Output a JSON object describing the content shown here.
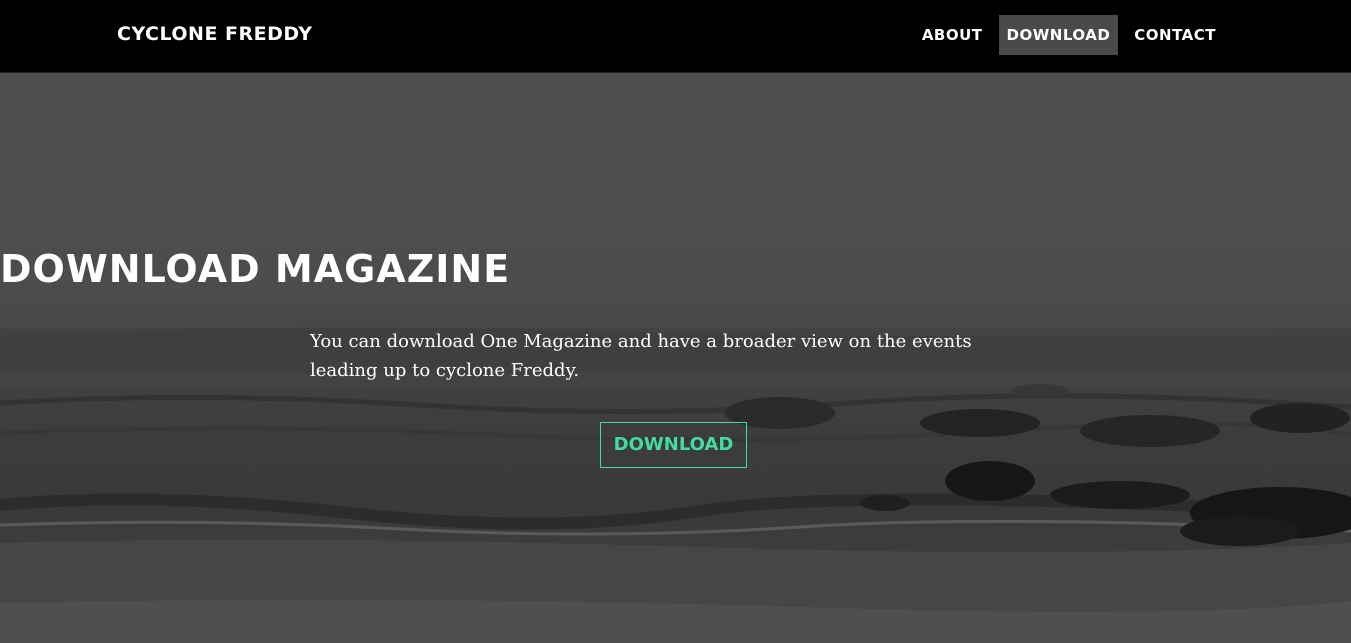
{
  "navbar": {
    "brand": "CYCLONE FREDDY",
    "links": [
      {
        "label": "ABOUT"
      },
      {
        "label": "DOWNLOAD"
      },
      {
        "label": "CONTACT"
      }
    ],
    "active": "DOWNLOAD"
  },
  "hero": {
    "title": "DOWNLOAD MAGAZINE",
    "description": "You can download One Magazine and have a broader view on the events leading up to cyclone Freddy.",
    "button_label": "DOWNLOAD"
  },
  "colors": {
    "accent": "#42dca3",
    "navbar_bg": "#000000",
    "active_nav_bg": "#4a4a4a",
    "text": "#ffffff"
  }
}
